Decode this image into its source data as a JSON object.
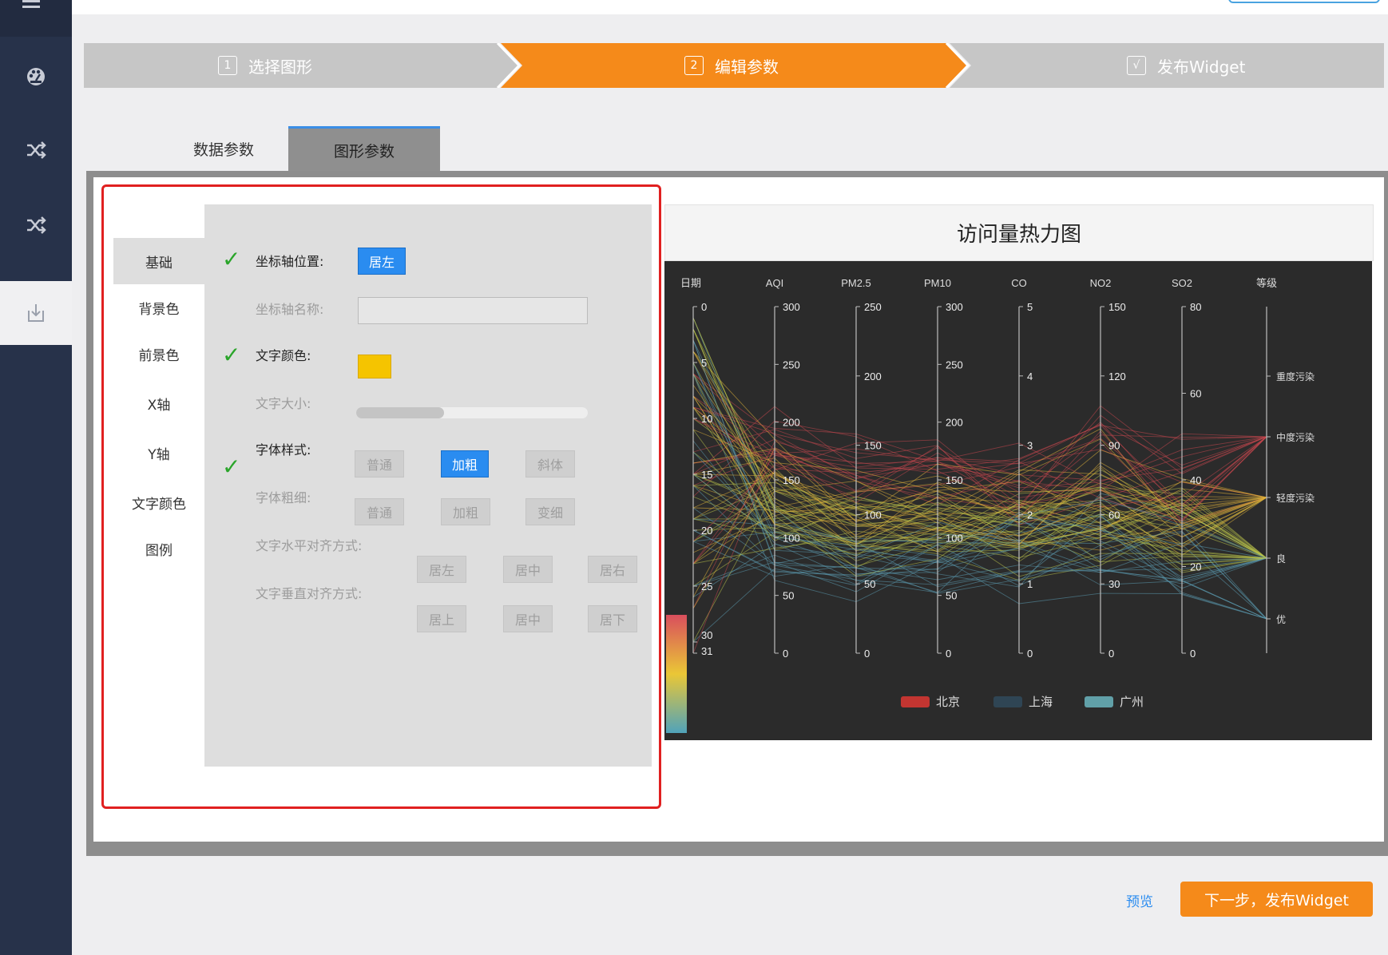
{
  "steps": [
    {
      "num": "1",
      "label": "选择图形",
      "state": "done"
    },
    {
      "num": "2",
      "label": "编辑参数",
      "state": "active"
    },
    {
      "num": "√",
      "label": "发布Widget",
      "state": "todo"
    }
  ],
  "colors": {
    "step_gray": "#c6c6c6",
    "step_active": "#f58a1a",
    "accent_blue": "#2a8cf0",
    "sidebar": "#27324a"
  },
  "sidebar": {
    "icons": [
      "menu-icon",
      "dashboard-icon",
      "shuffle-icon",
      "shuffle-icon",
      "download-icon"
    ]
  },
  "tabs": {
    "data": "数据参数",
    "shape": "图形参数"
  },
  "menu": {
    "items": [
      "基础",
      "背景色",
      "前景色",
      "X轴",
      "Y轴",
      "文字颜色",
      "图例"
    ]
  },
  "settings": {
    "axis_position_label": "坐标轴位置:",
    "axis_position_value": "居左",
    "axis_name_label": "坐标轴名称:",
    "axis_name_value": "",
    "text_color_label": "文字颜色:",
    "text_color_value": "#f5c400",
    "text_size_label": "文字大小:",
    "text_size_fraction": 0.38,
    "font_style_label": "字体样式:",
    "font_style_options": [
      "普通",
      "加粗",
      "斜体"
    ],
    "font_weight_label": "字体粗细:",
    "font_weight_options": [
      "普通",
      "加粗",
      "变细"
    ],
    "h_align_label": "文字水平对齐方式:",
    "h_align_options": [
      "居左",
      "居中",
      "居右"
    ],
    "v_align_label": "文字垂直对齐方式:",
    "v_align_options": [
      "居上",
      "居中",
      "居下"
    ]
  },
  "chart": {
    "title": "访问量热力图"
  },
  "chart_data": {
    "type": "parallel",
    "axes": [
      {
        "name": "日期",
        "min": 0,
        "max": 31,
        "ticks": [
          0,
          5,
          10,
          15,
          20,
          25,
          30,
          31
        ],
        "inverse": true
      },
      {
        "name": "AQI",
        "min": 0,
        "max": 300,
        "ticks": [
          0,
          50,
          100,
          150,
          200,
          250,
          300
        ]
      },
      {
        "name": "PM2.5",
        "min": 0,
        "max": 250,
        "ticks": [
          0,
          50,
          100,
          150,
          200,
          250
        ]
      },
      {
        "name": "PM10",
        "min": 0,
        "max": 300,
        "ticks": [
          0,
          50,
          100,
          150,
          200,
          250,
          300
        ]
      },
      {
        "name": "CO",
        "min": 0,
        "max": 5,
        "ticks": [
          0,
          1,
          2,
          3,
          4,
          5
        ]
      },
      {
        "name": "NO2",
        "min": 0,
        "max": 150,
        "ticks": [
          0,
          30,
          60,
          90,
          120,
          150
        ]
      },
      {
        "name": "SO2",
        "min": 0,
        "max": 80,
        "ticks": [
          0,
          20,
          40,
          60,
          80
        ]
      },
      {
        "name": "等级",
        "categories": [
          "优",
          "良",
          "轻度污染",
          "中度污染",
          "重度污染"
        ]
      }
    ],
    "series": [
      {
        "name": "北京",
        "color": "#c23531"
      },
      {
        "name": "上海",
        "color": "#2f4554"
      },
      {
        "name": "广州",
        "color": "#61a0a8"
      }
    ],
    "legend_position": "bottom-center",
    "visual_map_colors": [
      "#d94e5d",
      "#eac736",
      "#50a3ba"
    ]
  },
  "footer": {
    "preview": "预览",
    "next": "下一步，发布Widget"
  }
}
